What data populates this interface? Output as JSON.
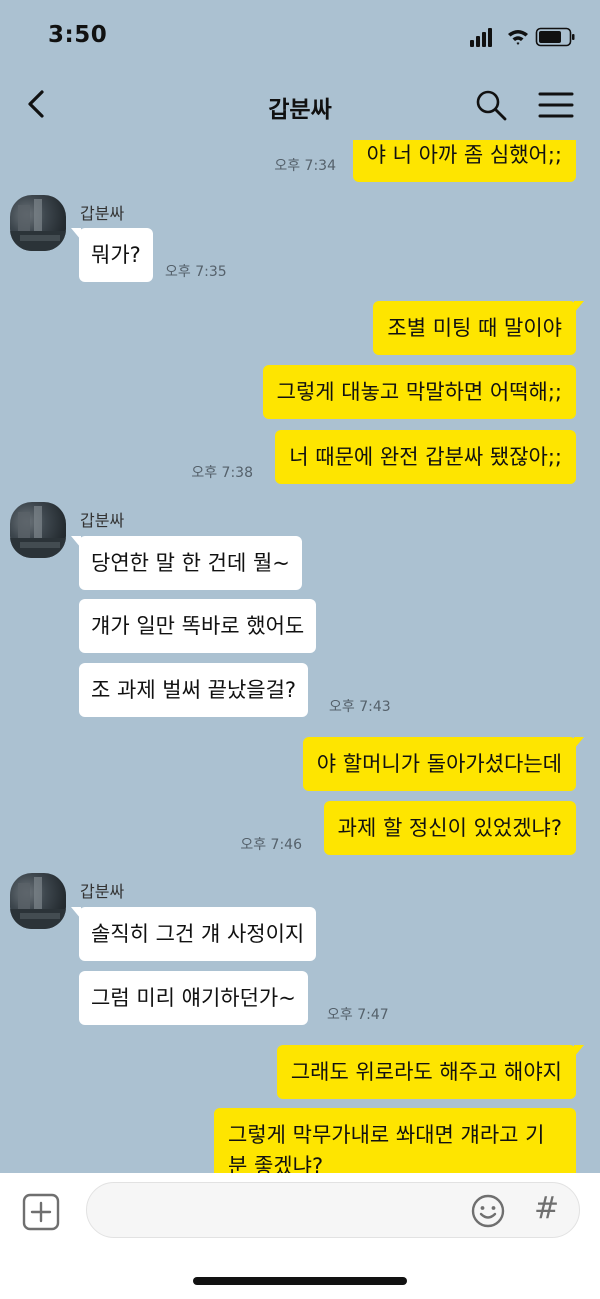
{
  "status": {
    "time": "3:50"
  },
  "header": {
    "title": "갑분싸"
  },
  "conversation": {
    "sender_name": "갑분싸",
    "messages": [
      {
        "text": "야 너 아까 좀 심했어;;",
        "time": "오후 7:34"
      },
      {
        "text": "뭐가?",
        "time": "오후 7:35"
      },
      {
        "text": "조별 미팅 때 말이야"
      },
      {
        "text": "그렇게 대놓고 막말하면 어떡해;;"
      },
      {
        "text": "너 때문에 완전 갑분싸 됐잖아;;",
        "time": "오후 7:38"
      },
      {
        "text": "당연한 말 한 건데 뭘~"
      },
      {
        "text": "걔가 일만 똑바로 했어도"
      },
      {
        "text": "조 과제 벌써 끝났을걸?",
        "time": "오후 7:43"
      },
      {
        "text": "야 할머니가 돌아가셨다는데"
      },
      {
        "text": "과제 할 정신이 있었겠냐?",
        "time": "오후 7:46"
      },
      {
        "text": "솔직히 그건 걔 사정이지"
      },
      {
        "text": "그럼 미리 얘기하던가~",
        "time": "오후 7:47"
      },
      {
        "text": "그래도 위로라도 해주고 해야지"
      },
      {
        "text": "그렇게 막무가내로 쏴대면 걔라고 기분 좋겠냐?"
      }
    ]
  },
  "input": {
    "placeholder": "",
    "hash_label": "#"
  },
  "colors": {
    "background": "#ABC1D1",
    "my_bubble": "#FEE500",
    "their_bubble": "#FFFFFF"
  },
  "icons": [
    "back-icon",
    "search-icon",
    "menu-icon",
    "plus-icon",
    "emoji-icon",
    "hash-icon",
    "signal-icon",
    "wifi-icon",
    "battery-icon"
  ]
}
